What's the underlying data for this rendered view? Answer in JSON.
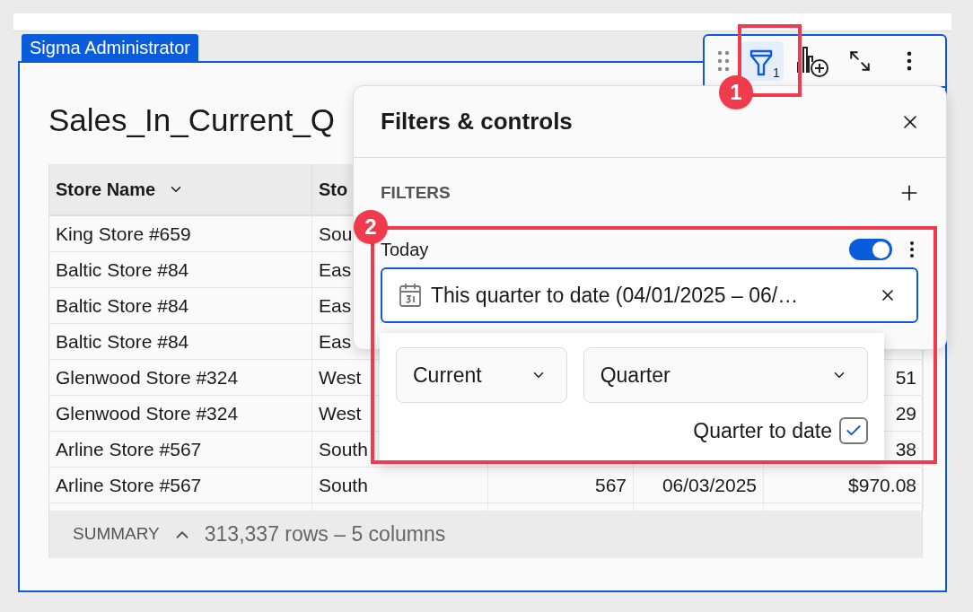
{
  "tag": "Sigma Administrator",
  "toolbar": {
    "filter_count": "1",
    "filter_selected": true
  },
  "title": "Sales_In_Current_Q",
  "table": {
    "columns": [
      {
        "label": "Store Name"
      },
      {
        "label": "Sto"
      }
    ],
    "rows": [
      {
        "store_name": "King Store #659",
        "column_2": "Sou"
      },
      {
        "store_name": "Baltic Store #84",
        "column_2": "Eas"
      },
      {
        "store_name": "Baltic Store #84",
        "column_2": "Eas"
      },
      {
        "store_name": "Baltic Store #84",
        "column_2": "Eas"
      },
      {
        "store_name": "Glenwood Store #324",
        "column_2": "West",
        "column_5": "51"
      },
      {
        "store_name": "Glenwood Store #324",
        "column_2": "West",
        "column_5": "29"
      },
      {
        "store_name": "Arline Store #567",
        "column_2": "South",
        "column_5": "38"
      },
      {
        "store_name": "Arline Store #567",
        "column_2": "South",
        "column_3": "567",
        "column_4": "06/03/2025",
        "column_5": "$970.08"
      }
    ]
  },
  "summary": {
    "label": "SUMMARY",
    "count": "313,337 rows – 5 columns"
  },
  "panel": {
    "title": "Filters & controls",
    "section": "FILTERS",
    "filter": {
      "label": "Today",
      "on": true,
      "value": "This quarter to date (04/01/2025 – 06/…"
    }
  },
  "dropdown": {
    "selects": [
      "Current",
      "Quarter"
    ],
    "option": {
      "label": "Quarter to date",
      "checked": true
    }
  },
  "annotations": [
    {
      "number": "1"
    },
    {
      "number": "2"
    }
  ]
}
